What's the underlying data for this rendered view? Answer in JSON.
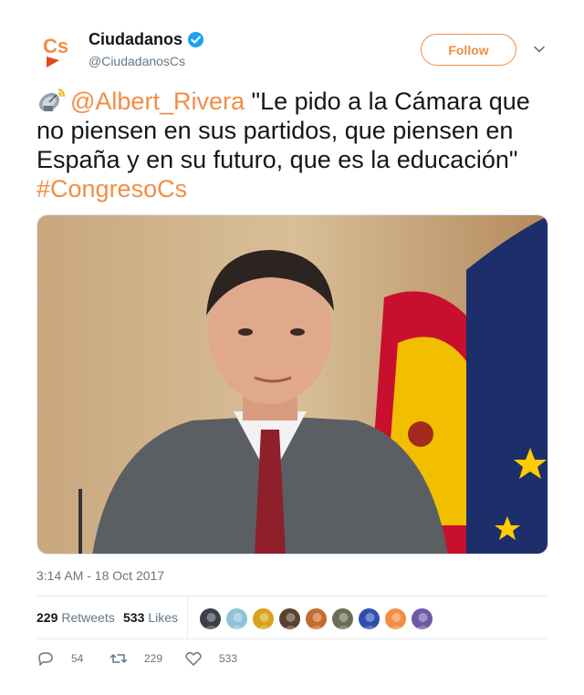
{
  "account": {
    "name": "Ciudadanos",
    "handle": "@CiudadanosCs",
    "logo_text": "Cs",
    "brand_color": "#f28d45",
    "verified_color": "#1da1f2"
  },
  "follow_label": "Follow",
  "tweet": {
    "lead_icon": "satellite-antenna-icon",
    "mention": "@Albert_Rivera",
    "quote": " \"Le pido a la Cámara que no piensen en sus partidos, que piensen en España y en su futuro, que es la educación\"",
    "hashtag": "#CongresoCs"
  },
  "timestamp": "3:14 AM - 18 Oct 2017",
  "stats": {
    "retweets_count": "229",
    "retweets_label": "Retweets",
    "likes_count": "533",
    "likes_label": "Likes"
  },
  "actions": {
    "reply_count": "54",
    "retweet_count": "229",
    "like_count": "533"
  },
  "liker_avatars": [
    {
      "color": "#3a3f4a"
    },
    {
      "color": "#8ec3d6"
    },
    {
      "color": "#d9a21a"
    },
    {
      "color": "#5a4030"
    },
    {
      "color": "#c66a2e"
    },
    {
      "color": "#6b6e55"
    },
    {
      "color": "#2f4fb0"
    },
    {
      "color": "#f28d45"
    },
    {
      "color": "#6e59a6"
    }
  ]
}
